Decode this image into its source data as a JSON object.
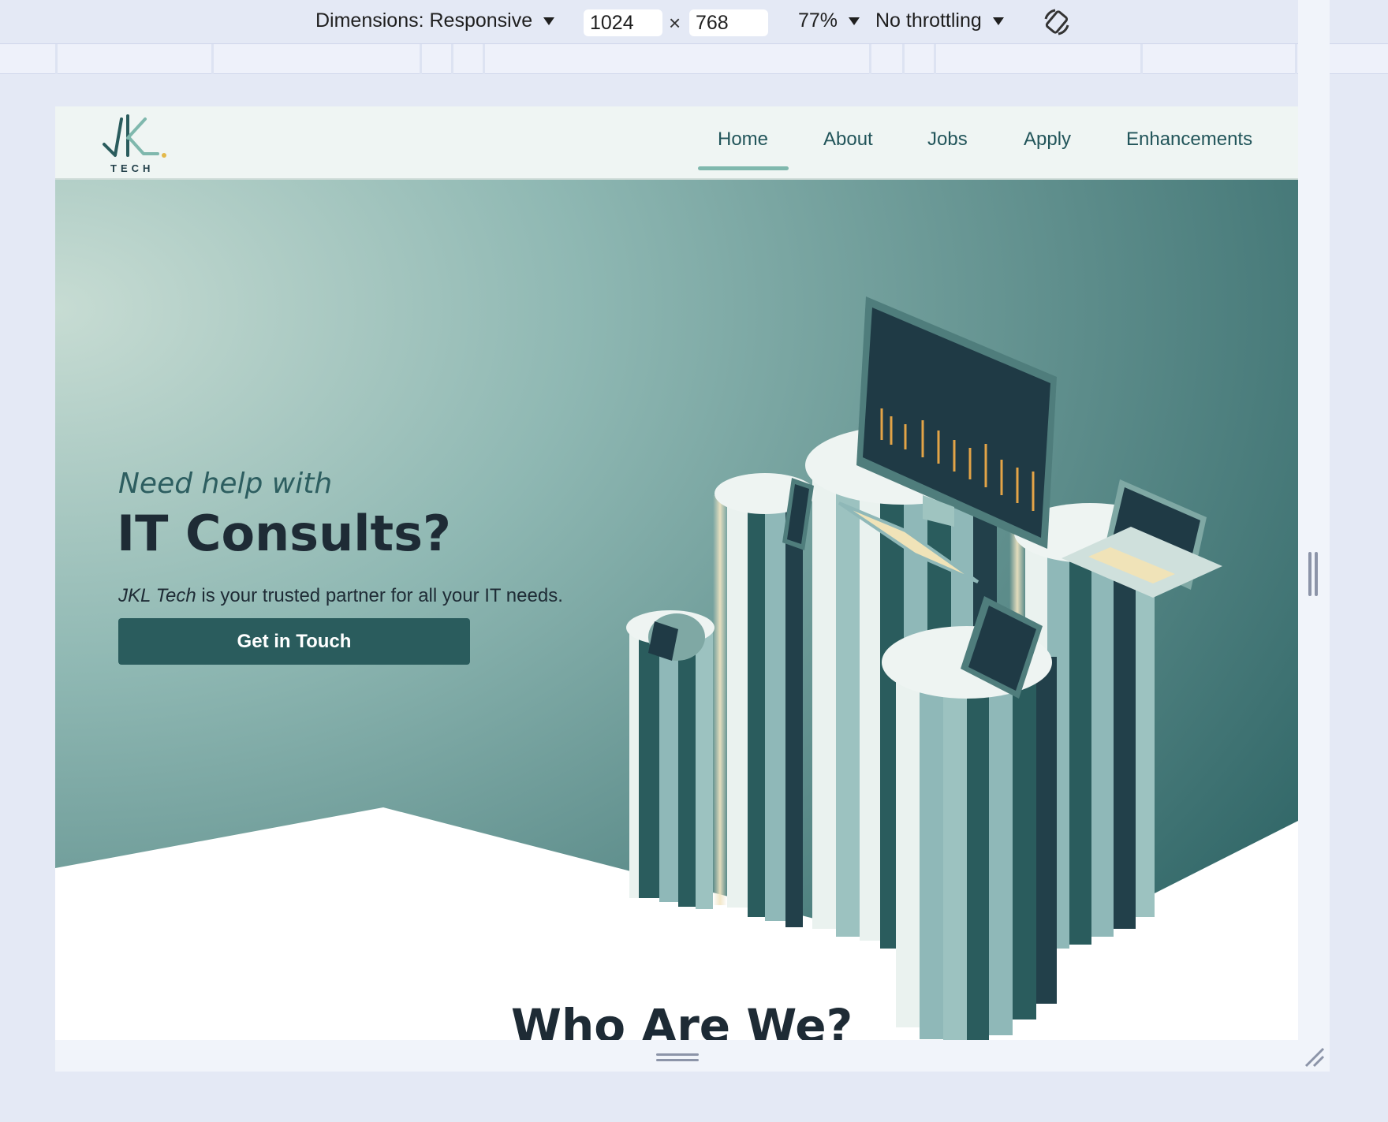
{
  "devtools": {
    "dimensions_label": "Dimensions: Responsive",
    "width": "1024",
    "height": "768",
    "times_symbol": "×",
    "zoom": "77%",
    "throttling": "No throttling"
  },
  "site": {
    "logo_text": "TECH",
    "nav": {
      "home": "Home",
      "about": "About",
      "jobs": "Jobs",
      "apply": "Apply",
      "enhancements": "Enhancements"
    },
    "hero": {
      "kicker": "Need help with",
      "headline": "IT Consults?",
      "brand": "JKL Tech",
      "subtext": " is your trusted partner for all your IT needs.",
      "cta": "Get in Touch"
    },
    "section_title": "Who Are We?"
  },
  "colors": {
    "primary": "#2a5c5d",
    "accent": "#7fb8ad",
    "heading": "#1e2b35"
  }
}
